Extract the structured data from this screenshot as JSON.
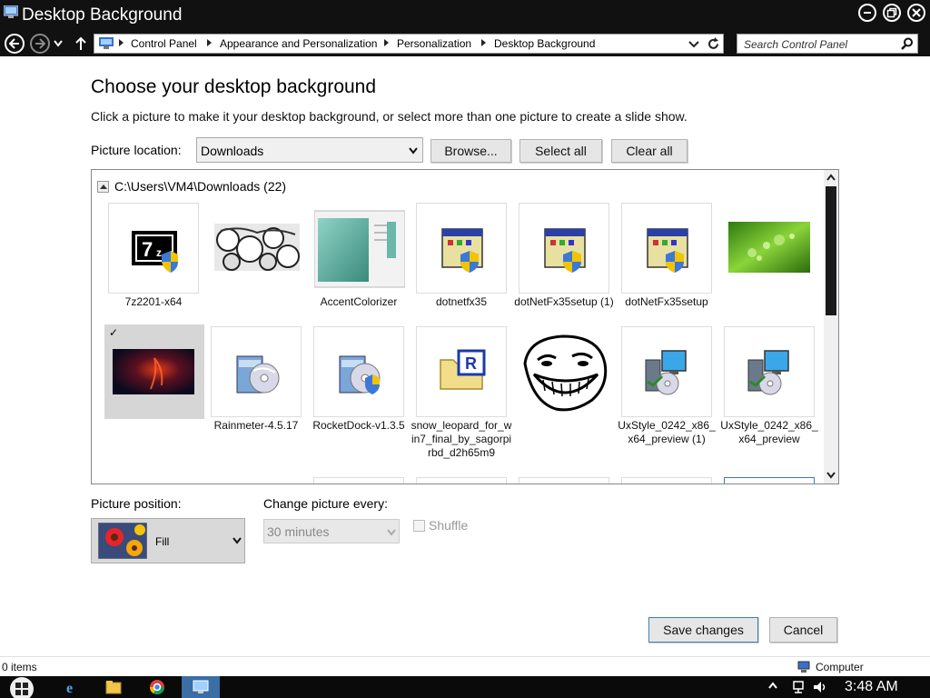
{
  "window": {
    "title": "Desktop Background"
  },
  "address": {
    "crumbs": [
      "Control Panel",
      "Appearance and Personalization",
      "Personalization",
      "Desktop Background"
    ],
    "search_placeholder": "Search Control Panel"
  },
  "page": {
    "heading": "Choose your desktop background",
    "subtitle": "Click a picture to make it your desktop background, or select more than one picture to create a slide show.",
    "picture_location_label": "Picture location:",
    "picture_location_value": "Downloads",
    "browse_label": "Browse...",
    "select_all_label": "Select all",
    "clear_all_label": "Clear all"
  },
  "gallery": {
    "group_title": "C:\\Users\\VM4\\Downloads (22)",
    "items": [
      {
        "label": "7z2201-x64",
        "icon": "7zip-installer-icon"
      },
      {
        "label": "",
        "icon": "meme-collage-image"
      },
      {
        "label": "AccentColorizer",
        "icon": "accent-colorizer-screenshot"
      },
      {
        "label": "dotnetfx35",
        "icon": "installer-window-icon"
      },
      {
        "label": "dotNetFx35setup (1)",
        "icon": "installer-window-icon"
      },
      {
        "label": "dotNetFx35setup",
        "icon": "installer-window-icon"
      },
      {
        "label": "",
        "icon": "green-bokeh-image"
      },
      {
        "label": "",
        "icon": "red-smoke-wallpaper",
        "selected": true,
        "check": "✓"
      },
      {
        "label": "Rainmeter-4.5.17",
        "icon": "setup-disc-icon"
      },
      {
        "label": "RocketDock-v1.3.5",
        "icon": "setup-disc-shield-icon"
      },
      {
        "label": "snow_leopard_for_win7_final_by_sagorpirbd_d2h65m9",
        "icon": "rar-archive-icon"
      },
      {
        "label": "",
        "icon": "troll-face-image"
      },
      {
        "label": "UxStyle_0242_x86_x64_preview (1)",
        "icon": "installer-computer-icon"
      },
      {
        "label": "UxStyle_0242_x86_x64_preview",
        "icon": "installer-computer-icon"
      }
    ]
  },
  "options": {
    "picture_position_label": "Picture position:",
    "picture_position_value": "Fill",
    "change_every_label": "Change picture every:",
    "change_every_value": "30 minutes",
    "shuffle_label": "Shuffle"
  },
  "actions": {
    "save_label": "Save changes",
    "cancel_label": "Cancel"
  },
  "status": {
    "items_text": "0 items",
    "location_text": "Computer"
  },
  "taskbar": {
    "clock": "3:48 AM"
  }
}
